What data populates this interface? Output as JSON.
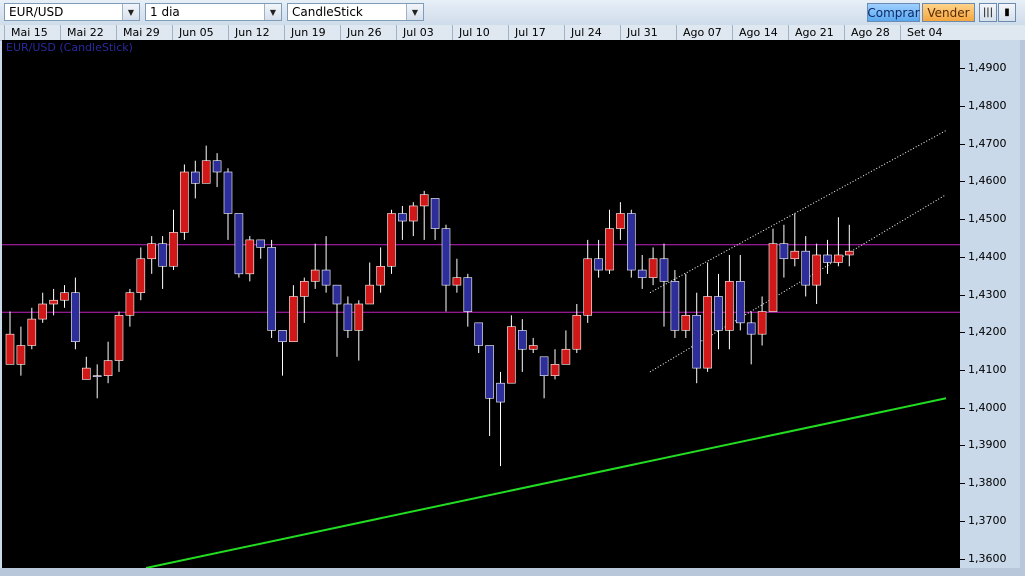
{
  "toolbar": {
    "symbol": "EUR/USD",
    "timeframe": "1 dia",
    "chart_style": "CandleStick",
    "buy_label": "Comprar",
    "sell_label": "Vender",
    "icon_bars": "bars-icon",
    "icon_lock": "lock-icon"
  },
  "colors": {
    "background": "#000000",
    "bull": "#2e2e9a",
    "bear": "#d01818",
    "wick": "#ffffff",
    "horizontal_line": "#c020c0",
    "trend_line": "#22dd22",
    "channel_line": "#ffffff"
  },
  "chart_data": {
    "type": "candlestick",
    "title": "EUR/USD (CandleStick)",
    "timeframe": "1 dia",
    "x_tick_labels": [
      "Mai 15",
      "Mai 22",
      "Mai 29",
      "Jun 05",
      "Jun 12",
      "Jun 19",
      "Jun 26",
      "Jul 03",
      "Jul 10",
      "Jul 17",
      "Jul 24",
      "Jul 31",
      "Ago 07",
      "Ago 14",
      "Ago 21",
      "Ago 28",
      "Set 04"
    ],
    "y_tick_labels": [
      "1,4900",
      "1,4800",
      "1,4700",
      "1,4600",
      "1,4500",
      "1,4400",
      "1,4300",
      "1,4200",
      "1,4100",
      "1,4000",
      "1,3900",
      "1,3800",
      "1,3700",
      "1,3600"
    ],
    "ylim": [
      1.3575,
      1.4975
    ],
    "candles": [
      [
        1.4195,
        1.4255,
        1.4145,
        1.4115
      ],
      [
        1.4165,
        1.4215,
        1.4085,
        1.4115
      ],
      [
        1.4235,
        1.4265,
        1.4155,
        1.4165
      ],
      [
        1.4275,
        1.4305,
        1.4225,
        1.4235
      ],
      [
        1.4285,
        1.4315,
        1.4245,
        1.4275
      ],
      [
        1.4305,
        1.4325,
        1.4265,
        1.4285
      ],
      [
        1.4175,
        1.4345,
        1.4155,
        1.4305
      ],
      [
        1.4105,
        1.4135,
        1.4075,
        1.4075
      ],
      [
        1.4085,
        1.4115,
        1.4025,
        1.4085
      ],
      [
        1.4125,
        1.4175,
        1.4065,
        1.4085
      ],
      [
        1.4245,
        1.4255,
        1.4095,
        1.4125
      ],
      [
        1.4305,
        1.4315,
        1.4215,
        1.4245
      ],
      [
        1.4395,
        1.4425,
        1.4285,
        1.4305
      ],
      [
        1.4435,
        1.4455,
        1.4355,
        1.4395
      ],
      [
        1.4375,
        1.4455,
        1.4315,
        1.4435
      ],
      [
        1.4465,
        1.4525,
        1.4365,
        1.4375
      ],
      [
        1.4625,
        1.4645,
        1.4445,
        1.4465
      ],
      [
        1.4595,
        1.4655,
        1.4555,
        1.4625
      ],
      [
        1.4655,
        1.4695,
        1.4595,
        1.4595
      ],
      [
        1.4625,
        1.4675,
        1.4585,
        1.4655
      ],
      [
        1.4515,
        1.4635,
        1.4445,
        1.4625
      ],
      [
        1.4355,
        1.4515,
        1.4345,
        1.4515
      ],
      [
        1.4445,
        1.4455,
        1.4335,
        1.4355
      ],
      [
        1.4425,
        1.4445,
        1.4395,
        1.4445
      ],
      [
        1.4205,
        1.4445,
        1.4185,
        1.4425
      ],
      [
        1.4175,
        1.4205,
        1.4085,
        1.4205
      ],
      [
        1.4295,
        1.4325,
        1.4175,
        1.4175
      ],
      [
        1.4335,
        1.4345,
        1.4225,
        1.4295
      ],
      [
        1.4365,
        1.4435,
        1.4315,
        1.4335
      ],
      [
        1.4325,
        1.4455,
        1.4305,
        1.4365
      ],
      [
        1.4275,
        1.4325,
        1.4135,
        1.4325
      ],
      [
        1.4205,
        1.4295,
        1.4185,
        1.4275
      ],
      [
        1.4275,
        1.4285,
        1.4125,
        1.4205
      ],
      [
        1.4325,
        1.4385,
        1.4275,
        1.4275
      ],
      [
        1.4375,
        1.4425,
        1.4305,
        1.4325
      ],
      [
        1.4515,
        1.4525,
        1.4355,
        1.4375
      ],
      [
        1.4495,
        1.4535,
        1.4445,
        1.4515
      ],
      [
        1.4535,
        1.4545,
        1.4455,
        1.4495
      ],
      [
        1.4565,
        1.4575,
        1.4445,
        1.4535
      ],
      [
        1.4475,
        1.4555,
        1.4445,
        1.4555
      ],
      [
        1.4325,
        1.4485,
        1.4255,
        1.4475
      ],
      [
        1.4345,
        1.4395,
        1.4305,
        1.4325
      ],
      [
        1.4255,
        1.4355,
        1.4215,
        1.4345
      ],
      [
        1.4165,
        1.4225,
        1.4145,
        1.4225
      ],
      [
        1.4025,
        1.4165,
        1.3925,
        1.4165
      ],
      [
        1.4015,
        1.4095,
        1.3845,
        1.4065
      ],
      [
        1.4215,
        1.4245,
        1.4065,
        1.4065
      ],
      [
        1.4155,
        1.4235,
        1.4095,
        1.4205
      ],
      [
        1.4165,
        1.4185,
        1.4145,
        1.4155
      ],
      [
        1.4085,
        1.4135,
        1.4025,
        1.4135
      ],
      [
        1.4115,
        1.4155,
        1.4075,
        1.4085
      ],
      [
        1.4155,
        1.4205,
        1.4115,
        1.4115
      ],
      [
        1.4245,
        1.4275,
        1.4145,
        1.4155
      ],
      [
        1.4395,
        1.4445,
        1.4225,
        1.4245
      ],
      [
        1.4365,
        1.4445,
        1.4345,
        1.4395
      ],
      [
        1.4475,
        1.4525,
        1.4355,
        1.4365
      ],
      [
        1.4515,
        1.4545,
        1.4445,
        1.4475
      ],
      [
        1.4365,
        1.4525,
        1.4345,
        1.4515
      ],
      [
        1.4345,
        1.4405,
        1.4315,
        1.4365
      ],
      [
        1.4395,
        1.4425,
        1.4325,
        1.4345
      ],
      [
        1.4335,
        1.4435,
        1.4215,
        1.4395
      ],
      [
        1.4205,
        1.4365,
        1.4185,
        1.4335
      ],
      [
        1.4245,
        1.4355,
        1.4185,
        1.4205
      ],
      [
        1.4105,
        1.4305,
        1.4065,
        1.4245
      ],
      [
        1.4295,
        1.4385,
        1.4095,
        1.4105
      ],
      [
        1.4205,
        1.4355,
        1.4155,
        1.4295
      ],
      [
        1.4335,
        1.4405,
        1.4155,
        1.4205
      ],
      [
        1.4225,
        1.4405,
        1.4205,
        1.4335
      ],
      [
        1.4195,
        1.4255,
        1.4115,
        1.4225
      ],
      [
        1.4255,
        1.4295,
        1.4165,
        1.4195
      ],
      [
        1.4435,
        1.4475,
        1.4275,
        1.4255
      ],
      [
        1.4395,
        1.4485,
        1.4345,
        1.4435
      ],
      [
        1.4415,
        1.4515,
        1.4375,
        1.4395
      ],
      [
        1.4325,
        1.4455,
        1.4295,
        1.4415
      ],
      [
        1.4405,
        1.4435,
        1.4275,
        1.4325
      ],
      [
        1.4385,
        1.4445,
        1.4355,
        1.4405
      ],
      [
        1.4405,
        1.4505,
        1.4375,
        1.4385
      ],
      [
        1.4415,
        1.4485,
        1.4375,
        1.4405
      ]
    ],
    "horizontal_lines": [
      1.4432,
      1.4253
    ],
    "trend_lines": [
      {
        "kind": "support",
        "color": "green",
        "from": [
          "Mai 29",
          1.3575
        ],
        "to": [
          "Set 08",
          1.4025
        ]
      },
      {
        "kind": "channel-upper",
        "color": "white-dotted",
        "from": [
          "Jul 31",
          1.4305
        ],
        "to": [
          "Set 08",
          1.4735
        ]
      },
      {
        "kind": "channel-lower",
        "color": "white-dotted",
        "from": [
          "Jul 31",
          1.4095
        ],
        "to": [
          "Set 08",
          1.4565
        ]
      }
    ]
  }
}
